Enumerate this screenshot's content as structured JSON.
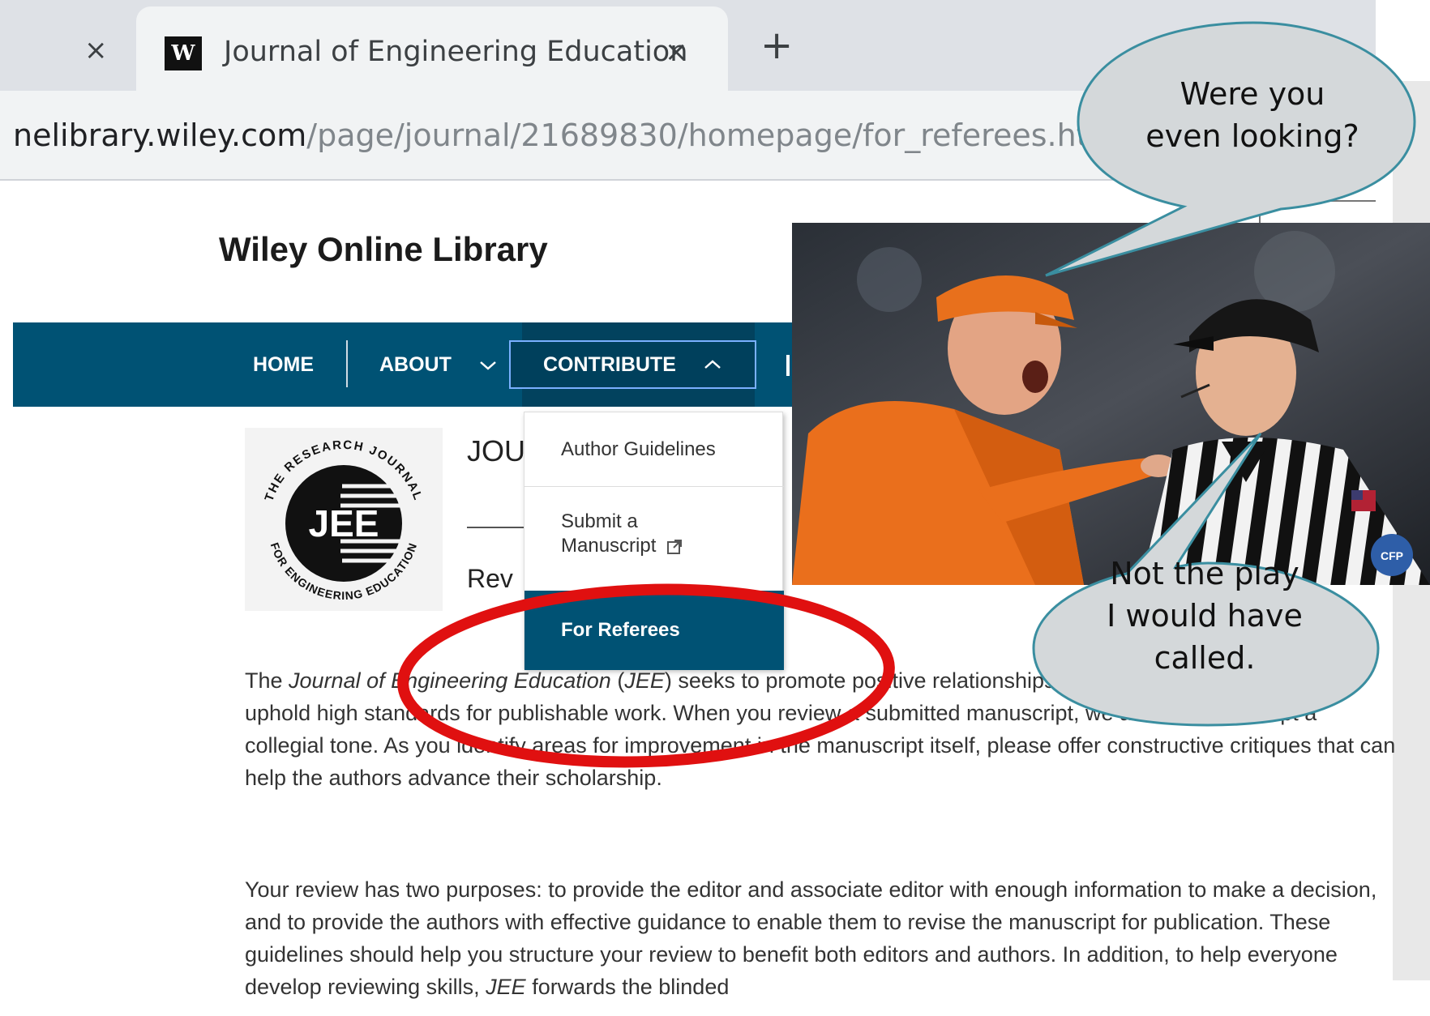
{
  "browser": {
    "tab_close_glyph": "×",
    "active_tab": {
      "favicon_letter": "W",
      "title": "Journal of Engineering Education",
      "close_glyph": "×"
    },
    "new_tab_glyph": "+",
    "url_domain": "nelibrary.wiley.com",
    "url_path": "/page/journal/21689830/homepage/for_referees.ht"
  },
  "site": {
    "title": "Wiley Online Library",
    "nav": {
      "home": "HOME",
      "about": "ABOUT",
      "contribute": "CONTRIBUTE",
      "about_chevron": "⌄",
      "contribute_chevron": "^"
    },
    "dropdown": {
      "item_1": "Author Guidelines",
      "item_2_line1": "Submit a",
      "item_2_line2": "Manuscript",
      "item_2_icon": "external-link-icon",
      "item_3": "For Referees"
    },
    "heading_partial": "JOU",
    "subheading_partial": "Rev",
    "logo": {
      "center_text": "JEE",
      "ring_text_top": "THE RESEARCH JOURNAL",
      "ring_text_bottom": "FOR ENGINEERING EDUCATION"
    }
  },
  "content": {
    "para1_line1a": "The ",
    "para1_line1_em": "Journal of Engineering Education",
    "para1_line1b": " (",
    "para1_line1_em2": "JEE",
    "para1_line1c": ") seeks to promote positive relationships",
    "para1_rest": "peer reviewers, even as we uphold high standards for publishable work. When you review a submitted manuscript, we ask that you adopt a collegial tone. As you identify areas for improvement in the manuscript itself, please offer constructive critiques that can help the authors advance their scholarship.",
    "para2": "Your review has two purposes: to provide the editor and associate editor with enough information to make a decision, and to provide the authors with effective guidance to enable them to revise the manuscript for publication. These guidelines should help you structure your review to benefit both editors and authors. In addition, to help everyone develop reviewing skills,",
    "para2_em": "JEE",
    "para2_tail": "forwards the blinded"
  },
  "overlay": {
    "bubble_top_line1": "Were you",
    "bubble_top_line2": "even looking?",
    "bubble_bottom_line1": "Not the play",
    "bubble_bottom_line2": "I would have",
    "bubble_bottom_line3": "called.",
    "photo_caption": "coach arguing with referee",
    "highlight_color": "#e01010"
  },
  "colors": {
    "nav_bg": "#005274",
    "nav_active_bg": "#02425e",
    "bubble_fill": "#d4d8da",
    "bubble_stroke": "#3a8ea0",
    "tab_strip": "#dee1e6"
  }
}
